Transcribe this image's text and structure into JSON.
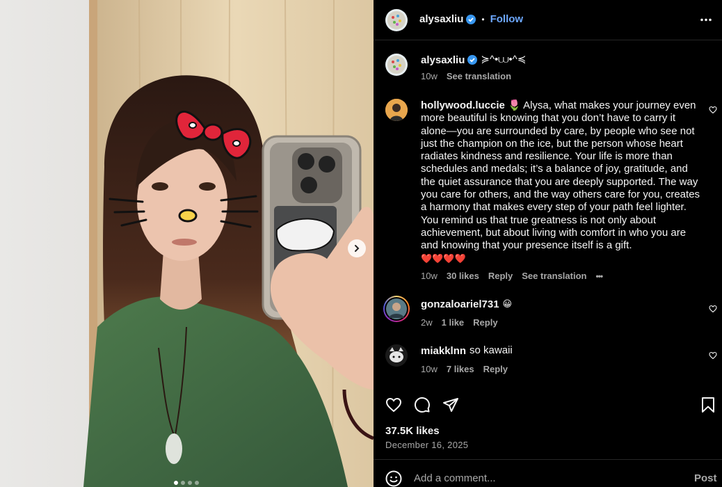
{
  "post": {
    "author": "alysaxliu",
    "follow_label": "Follow",
    "dot_sep": "•",
    "caption_author": "alysaxliu",
    "caption_text": "≽^•⩊•^≼",
    "caption_time": "10w",
    "see_translation": "See translation",
    "likes": "37.5K likes",
    "date": "December 16, 2025",
    "add_comment_placeholder": "Add a comment...",
    "post_label": "Post",
    "carousel": {
      "total": 4,
      "active": 1
    }
  },
  "comments": [
    {
      "user": "hollywood.luccie",
      "emoji_prefix": "🌷",
      "lines": [
        "Alysa, what makes your journey even",
        "more beautiful is knowing that you don’t have to carry it",
        "alone—you are surrounded by care, by people who see not",
        "just the champion on the ice, but the person whose heart",
        "radiates kindness and resilience. Your life is more than",
        "schedules and medals; it’s a balance of joy, gratitude, and",
        "the quiet assurance that you are deeply supported. The way",
        "you care for others, and the way others care for you, creates",
        "a harmony that makes every step of your path feel lighter.",
        "You remind us that true greatness is not only about",
        "achievement, but about living with comfort in who you are",
        "and knowing that your presence itself is a gift."
      ],
      "hearts": "❤️❤️❤️❤️",
      "time": "10w",
      "likes": "30 likes",
      "reply": "Reply",
      "see_translation": "See translation",
      "more": "•••"
    },
    {
      "user": "gonzaloariel731",
      "text": "😀",
      "time": "2w",
      "likes": "1 like",
      "reply": "Reply"
    },
    {
      "user": "miakklnn",
      "text": "so kawaii",
      "time": "10w",
      "likes": "7 likes",
      "reply": "Reply"
    }
  ],
  "icons": {
    "like": "heart-icon",
    "comment": "comment-icon",
    "share": "paper-plane-icon",
    "save": "bookmark-icon",
    "options": "more-options-icon",
    "emoji": "emoji-icon",
    "next": "chevron-right-icon"
  },
  "colors": {
    "background": "#000000",
    "text": "#f5f5f5",
    "muted": "#a8a8a8",
    "link": "#6da8ff",
    "verified": "#3897f0"
  }
}
